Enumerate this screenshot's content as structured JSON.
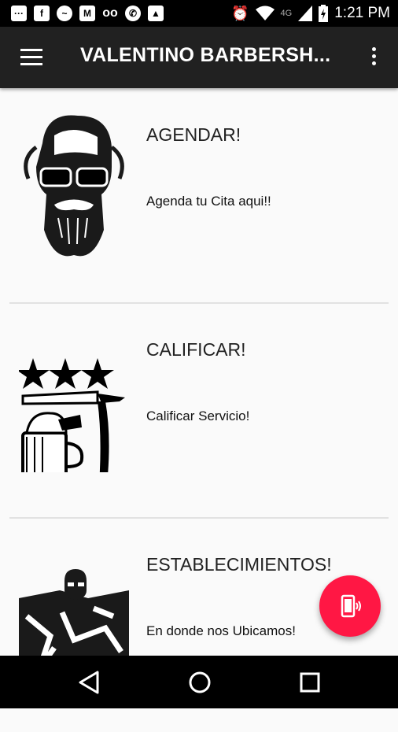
{
  "status_bar": {
    "network": "4G",
    "time": "1:21 PM",
    "icons_left": [
      "more-icon",
      "facebook-icon",
      "messenger-icon",
      "gmail-icon",
      "voicemail-icon",
      "whatsapp-icon",
      "image-icon"
    ],
    "icons_right": [
      "alarm-icon",
      "wifi-icon",
      "signal-icon",
      "battery-icon"
    ]
  },
  "app_bar": {
    "title": "VALENTINO BARBERSH...",
    "menu_icon": "menu-icon",
    "overflow_icon": "more-vert-icon"
  },
  "cards": [
    {
      "title": "AGENDAR!",
      "subtitle": "Agenda tu Cita aqui!!",
      "image": "bearded-skull-icon"
    },
    {
      "title": "CALIFICAR!",
      "subtitle": "Calificar Servicio!",
      "image": "razor-rating-icon"
    },
    {
      "title": "ESTABLECIMIENTOS!",
      "subtitle": "En donde nos Ubicamos!",
      "image": "map-location-icon"
    }
  ],
  "fab": {
    "icon": "phone-vibrate-icon",
    "color": "#ff1744"
  },
  "colors": {
    "app_bar": "#212121",
    "background": "#fafafa"
  },
  "nav_bar": {
    "buttons": [
      "back-icon",
      "home-icon",
      "recents-icon"
    ]
  }
}
